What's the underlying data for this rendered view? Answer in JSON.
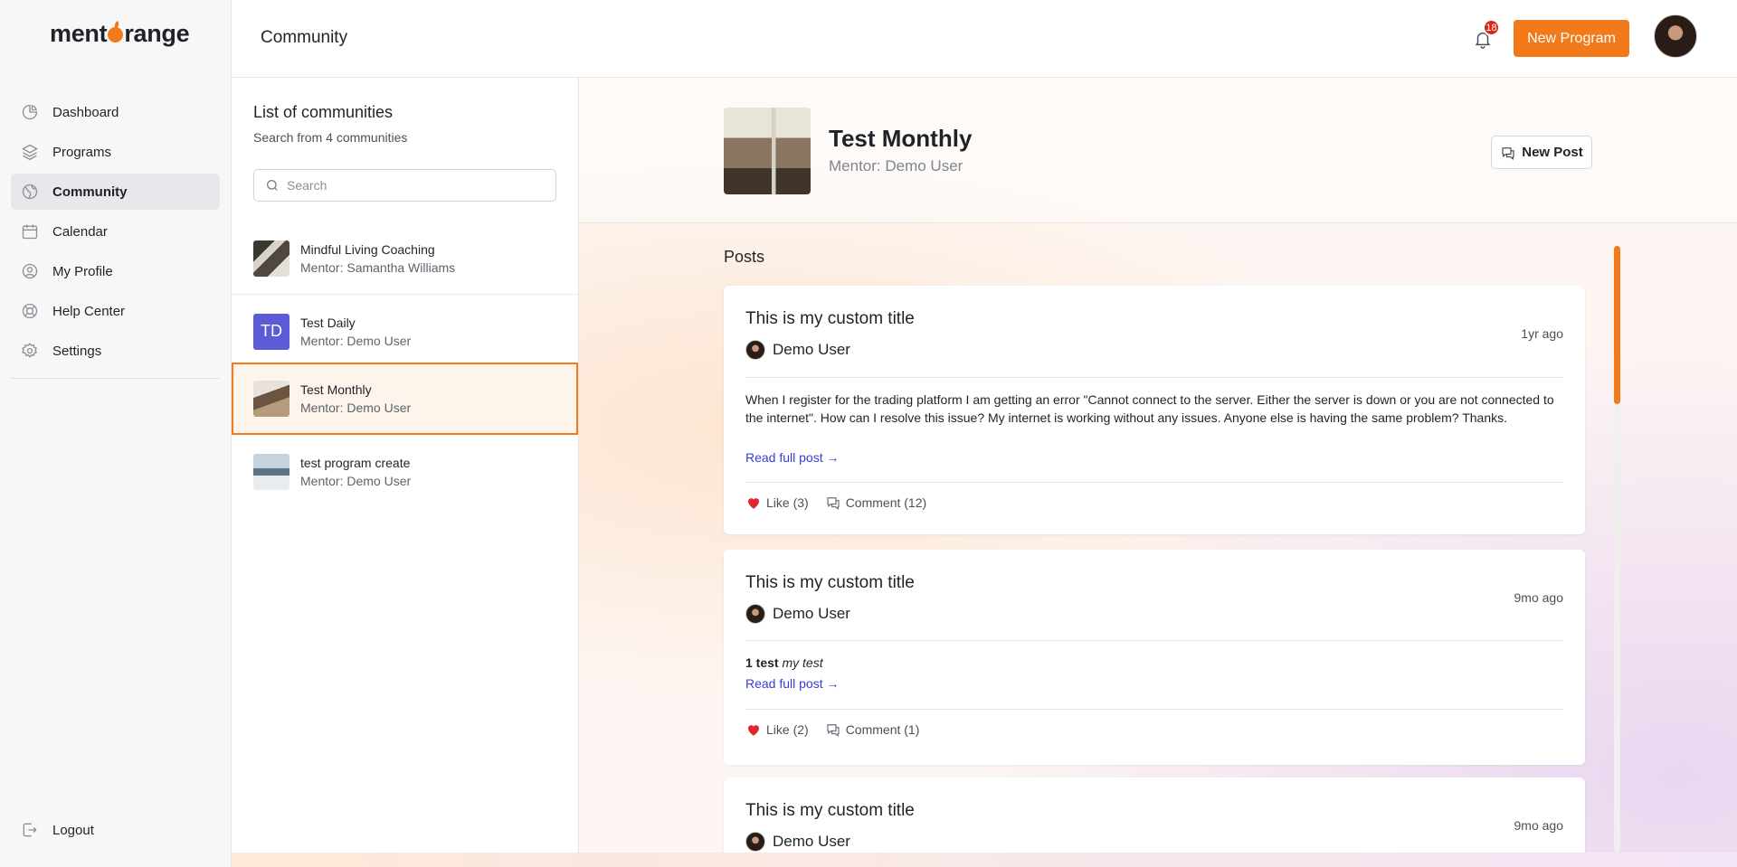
{
  "brand": {
    "name_prefix": "ment",
    "name_suffix": "range"
  },
  "sidebar": {
    "items": [
      {
        "label": "Dashboard",
        "icon": "dashboard-icon"
      },
      {
        "label": "Programs",
        "icon": "layers-icon"
      },
      {
        "label": "Community",
        "icon": "globe-icon"
      },
      {
        "label": "Calendar",
        "icon": "calendar-icon"
      },
      {
        "label": "My Profile",
        "icon": "user-circle-icon"
      },
      {
        "label": "Help Center",
        "icon": "lifebuoy-icon"
      },
      {
        "label": "Settings",
        "icon": "gear-icon"
      }
    ],
    "active": "Community",
    "logout": "Logout"
  },
  "header": {
    "title": "Community",
    "notification_count": "18",
    "new_program": "New Program"
  },
  "communities": {
    "title": "List of communities",
    "subtitle": "Search from 4 communities",
    "search_placeholder": "Search",
    "items": [
      {
        "name": "Mindful Living Coaching",
        "mentor": "Mentor: Samantha Williams"
      },
      {
        "name": "Test Daily",
        "mentor": "Mentor: Demo User",
        "initials": "TD"
      },
      {
        "name": "Test Monthly",
        "mentor": "Mentor: Demo User"
      },
      {
        "name": "test program create",
        "mentor": "Mentor: Demo User"
      }
    ],
    "selected": "Test Monthly"
  },
  "detail": {
    "title": "Test Monthly",
    "mentor": "Mentor: Demo User",
    "new_post": "New Post",
    "posts_heading": "Posts",
    "posts": [
      {
        "title": "This is my custom title",
        "author": "Demo User",
        "time": "1yr ago",
        "body": "When I register for the trading platform I am getting an error \"Cannot connect to the server. Either the server is down or you are not connected to the internet\". How can I resolve this issue? My internet is working without any issues. Anyone else is having the same problem? Thanks.",
        "read_more": "Read full post →",
        "like": "Like (3)",
        "comment": "Comment (12)"
      },
      {
        "title": "This is my custom title",
        "author": "Demo User",
        "time": "9mo ago",
        "body_bold": "1 test",
        "body_italic": "my test",
        "read_more": "Read full post →",
        "like": "Like (2)",
        "comment": "Comment (1)"
      },
      {
        "title": "This is my custom title",
        "author": "Demo User",
        "time": "9mo ago"
      }
    ]
  },
  "colors": {
    "accent": "#f27a1a",
    "link": "#3b3bd6",
    "heart": "#e0262f"
  }
}
